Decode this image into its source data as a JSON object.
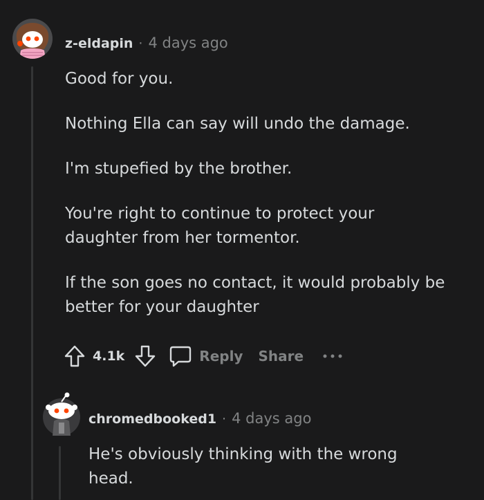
{
  "colors": {
    "background": "#1a1a1b",
    "text": "#d7dadc",
    "muted": "#818384",
    "thread_line": "#343536"
  },
  "comment": {
    "author": "z-eldapin",
    "separator": "·",
    "timestamp": "4 days ago",
    "paragraphs": [
      "Good for you.",
      "Nothing Ella can say will undo the damage.",
      "I'm stupefied by the brother.",
      "You're right to continue to protect your daughter from her tormentor.",
      "If the son goes no contact, it would probably be better for your daughter"
    ],
    "actions": {
      "upvote_icon": "upvote-arrow-icon",
      "score": "4.1k",
      "downvote_icon": "downvote-arrow-icon",
      "reply_icon": "speech-bubble-icon",
      "reply_label": "Reply",
      "share_label": "Share",
      "more_icon": "more-dots-icon"
    }
  },
  "reply": {
    "author": "chromedbooked1",
    "separator": "·",
    "timestamp": "4 days ago",
    "text": "He's obviously thinking with the wrong head."
  }
}
